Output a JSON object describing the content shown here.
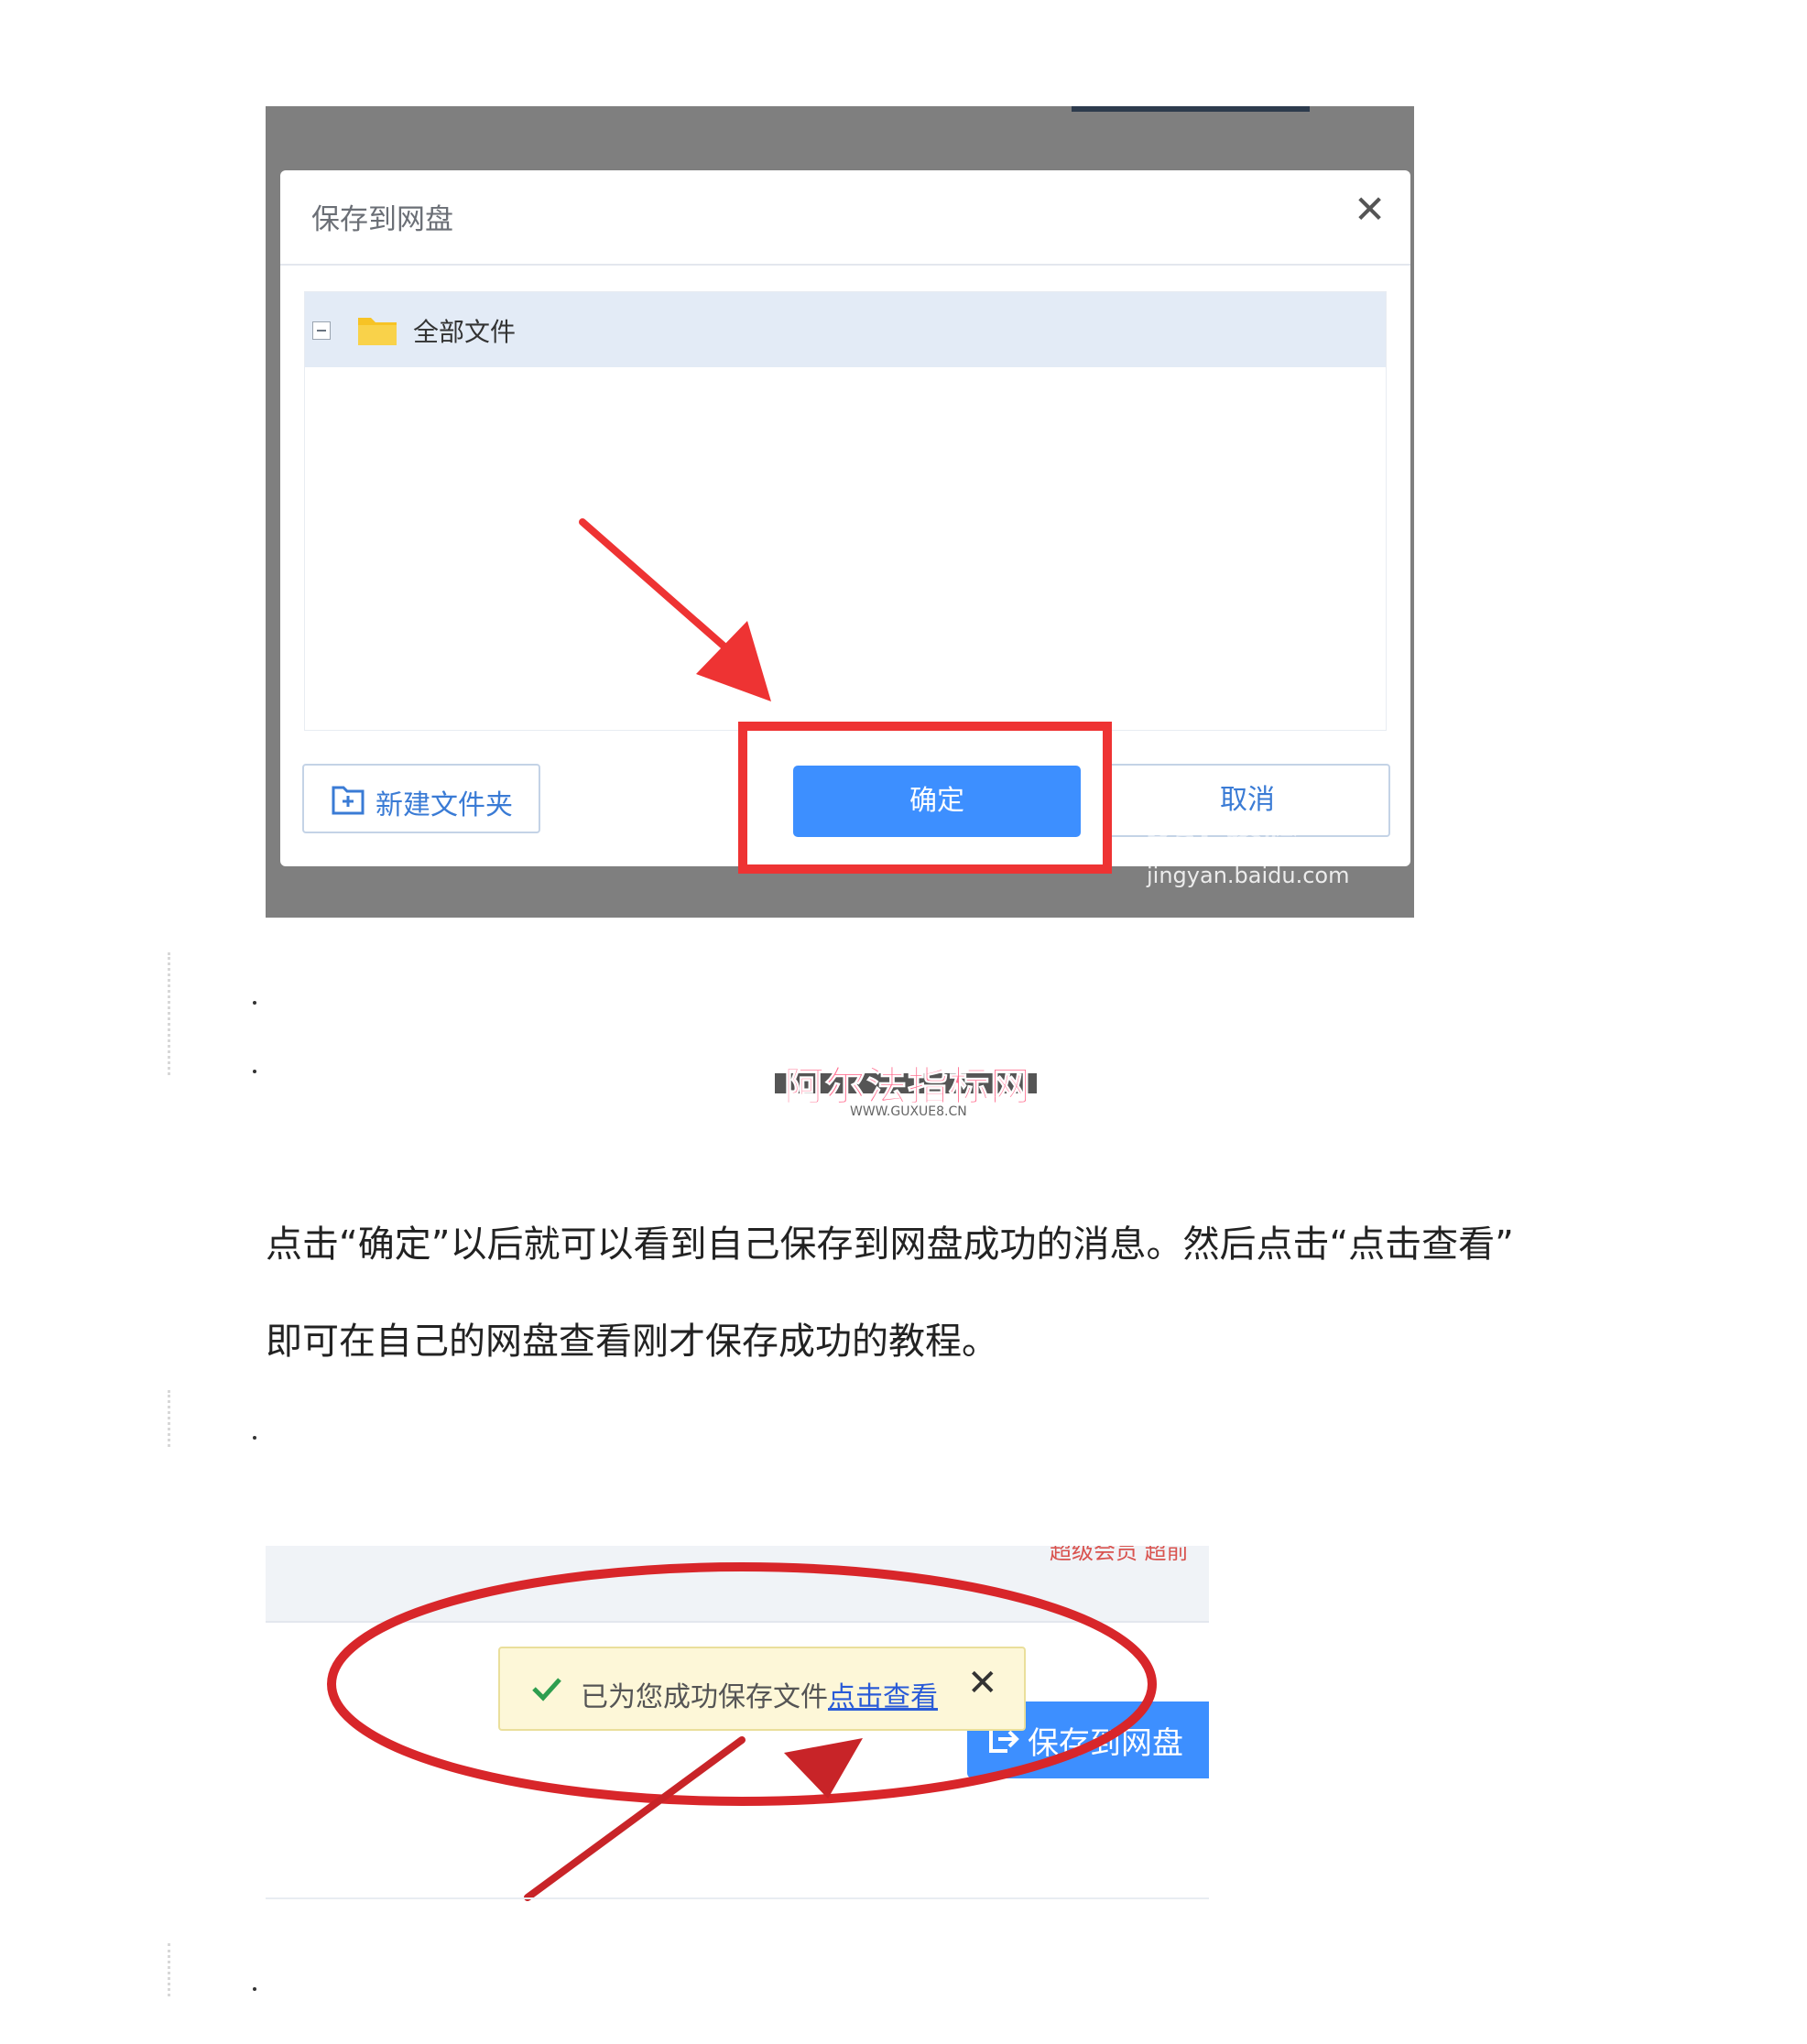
{
  "screenshot1": {
    "dialog_title": "保存到网盘",
    "close_glyph": "✕",
    "tree_root_label": "全部文件",
    "new_folder_button": "新建文件夹",
    "ok_button": "确定",
    "cancel_button": "取消",
    "watermark_brand": "Bai 经验",
    "watermark_url": "jingyan.baidu.com",
    "colors": {
      "primary": "#3d8fff",
      "highlight": "#ee3333",
      "overlay": "#7f7f7f",
      "folder": "#f7c325"
    },
    "icons": [
      "close-icon",
      "collapse-icon",
      "folder-icon",
      "new-folder-icon",
      "arrow-icon"
    ]
  },
  "site_watermark": {
    "name": "阿尔法指标网",
    "url": "WWW.GUXUE8.CN"
  },
  "paragraph": {
    "line1": "点击“确定”以后就可以看到自己保存到网盘成功的消息。然后点击“点击查看”",
    "line2": "即可在自己的网盘查看刚才保存成功的教程。"
  },
  "screenshot2": {
    "top_red_text": "超级会员 超前",
    "toast_text": "已为您成功保存文件",
    "toast_link": "点击查看",
    "close_glyph": "✕",
    "save_button": "保存到网盘",
    "colors": {
      "toast_bg": "#fdf7d8",
      "check": "#2e9e4f",
      "annotation": "#d8262a"
    },
    "icons": [
      "check-icon",
      "close-icon",
      "save-icon",
      "arrow-icon"
    ]
  },
  "bullets": [
    ".",
    ".",
    ".",
    "."
  ]
}
